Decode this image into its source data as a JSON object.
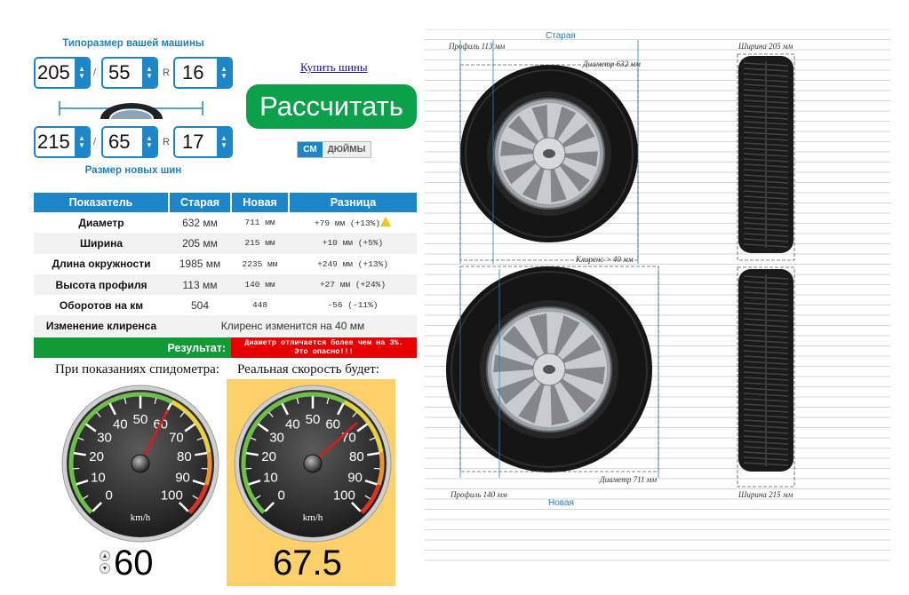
{
  "form": {
    "current_label": "Типоразмер вашей машины",
    "new_label": "Размер новых шин",
    "current": {
      "width": "205",
      "profile": "55",
      "rim_prefix": "R",
      "rim": "16"
    },
    "new": {
      "width": "215",
      "profile": "65",
      "rim_prefix": "R",
      "rim": "17"
    },
    "slash": "/",
    "buy_link": "Купить шины",
    "calc_button": "Рассчитать",
    "units": {
      "active": "СМ",
      "inactive": "ДЮЙМЫ"
    }
  },
  "table": {
    "headers": [
      "Показатель",
      "Старая",
      "Новая",
      "Разница"
    ],
    "rows": [
      {
        "label": "Диаметр",
        "old": "632 мм",
        "new": "711 мм",
        "diff": "+79 мм (+13%)",
        "warn": true
      },
      {
        "label": "Ширина",
        "old": "205 мм",
        "new": "215 мм",
        "diff": "+10 мм (+5%)"
      },
      {
        "label": "Длина окружности",
        "old": "1985 мм",
        "new": "2235 мм",
        "diff": "+249 мм (+13%)"
      },
      {
        "label": "Высота профиля",
        "old": "113 мм",
        "new": "140 мм",
        "diff": "+27 мм (+24%)"
      },
      {
        "label": "Оборотов на км",
        "old": "504",
        "new": "448",
        "diff": "-56 (-11%)"
      }
    ],
    "clearance_label": "Изменение клиренса",
    "clearance_value": "Клиренс изменится на 40 мм",
    "result_label": "Результат:",
    "result_line1": "Диаметр отличается более чем на 3%.",
    "result_line2": "Это опасно!!!"
  },
  "speed": {
    "shown_label": "При показаниях спидометра:",
    "real_label": "Реальная скорость будет:",
    "shown_value": "60",
    "real_value": "67.5",
    "unit": "km/h",
    "ticks": [
      "0",
      "10",
      "20",
      "30",
      "40",
      "50",
      "60",
      "70",
      "80",
      "90",
      "100"
    ],
    "shown_speed": 60,
    "real_speed": 67.5
  },
  "diagram": {
    "old_title": "Старая",
    "new_title": "Новая",
    "old_profile": "Профиль 113 мм",
    "old_width": "Ширина 205 мм",
    "old_diameter": "Диаметр 632 мм",
    "clearance": "Клиренс > 40 мм",
    "new_profile": "Профиль 140 мм",
    "new_diameter": "Диаметр 711 мм",
    "new_width": "Ширина 215 мм"
  },
  "colors": {
    "accent": "#1d86c8",
    "button": "#0ba14a",
    "danger": "#e60000",
    "ok": "#109b36",
    "real_bg": "#fdd06a"
  }
}
